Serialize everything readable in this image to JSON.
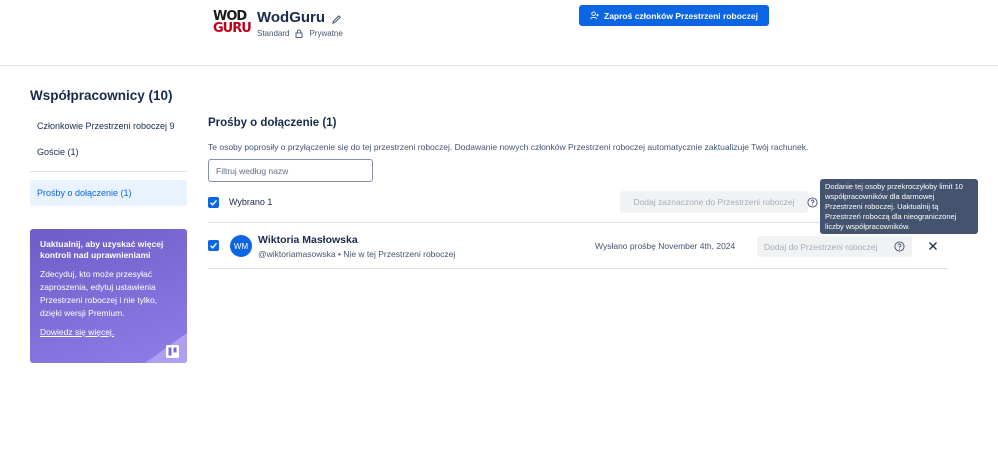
{
  "header": {
    "logo_line1": "WOD",
    "logo_line2": "GURU",
    "workspace_name": "WodGuru",
    "plan": "Standard",
    "visibility": "Prywatne",
    "invite_button": "Zaproś członków Przestrzeni roboczej"
  },
  "sidebar": {
    "title": "Współpracownicy (10)",
    "items": [
      {
        "label": "Członkowie Przestrzeni roboczej 9"
      },
      {
        "label": "Goście (1)"
      },
      {
        "label": "Prośby o dołączenie (1)"
      }
    ],
    "upgrade": {
      "title": "Uaktualnij, aby uzyskać więcej kontroli nad uprawnieniami",
      "text": "Zdecyduj, kto może przesyłać zaproszenia, edytuj ustawienia Przestrzeni roboczej i nie tylko, dzięki wersji Premium.",
      "link": "Dowiedz się więcej."
    }
  },
  "main": {
    "title": "Prośby o dołączenie (1)",
    "description": "Te osoby poprosiły o przyłączenie się do tej przestrzeni roboczej. Dodawanie nowych członków Przestrzeni roboczej automatycznie zaktualizuje Twój rachunek.",
    "filter_placeholder": "Filtruj według nazw",
    "selected_label": "Wybrano 1",
    "add_selected_button": "Dodaj zaznaczone do Przestrzeni roboczej",
    "tooltip": "Dodanie tej osoby przekroczyłoby limit 10 współpracowników dla darmowej Przestrzeni roboczej. Uaktualnij tą Przestrzeń roboczą dla nieograniczonej liczby współpracowników.",
    "requests": [
      {
        "initials": "WM",
        "name": "Wiktoria Masłowska",
        "sub": "@wiktoriamasowska • Nie w tej Przestrzeni roboczej",
        "sent": "Wysłano prośbę November 4th, 2024",
        "add_button": "Dodaj do Przestrzeni roboczej"
      }
    ]
  },
  "colors": {
    "primary": "#0c66e4",
    "upgrade_bg": "#7b6bd6",
    "tooltip_bg": "#44546f"
  }
}
